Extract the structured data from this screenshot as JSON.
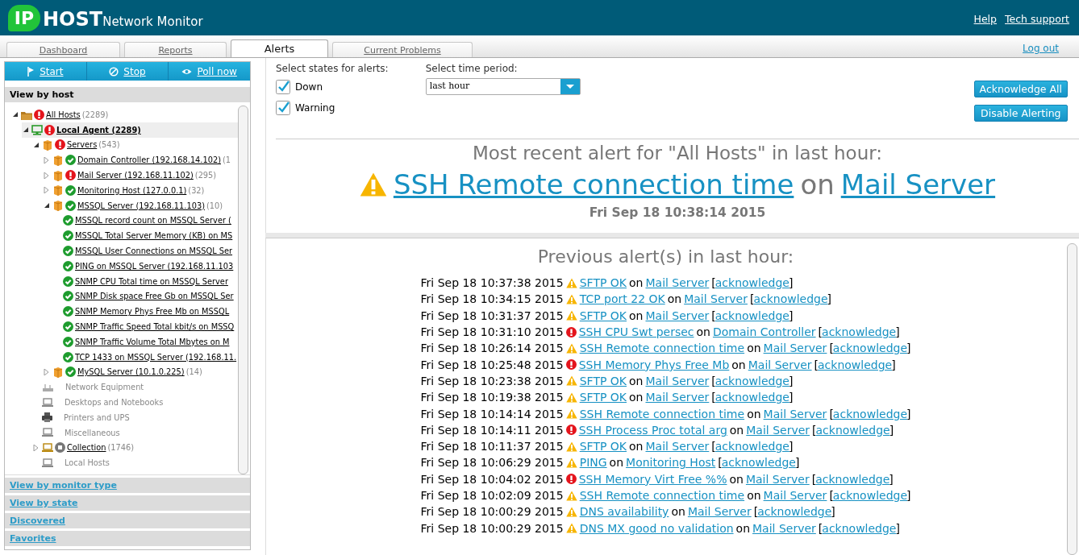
{
  "header": {
    "logo_badge": "IP",
    "logo_word": "HOST",
    "product": "Network Monitor",
    "links": [
      "Help",
      "Tech support"
    ]
  },
  "tabs": [
    {
      "label": "Dashboard",
      "selected": false
    },
    {
      "label": "Reports",
      "selected": false
    },
    {
      "label": "Alerts",
      "selected": true
    },
    {
      "label": "Current Problems",
      "selected": false
    }
  ],
  "logout": "Log out",
  "sidebar": {
    "actions": [
      {
        "kind": "start",
        "label": "Start"
      },
      {
        "kind": "stop",
        "label": "Stop"
      },
      {
        "kind": "poll",
        "label": "Poll now"
      }
    ],
    "active_section": "View by host",
    "tree": [
      {
        "kind": "folder",
        "down": true,
        "label": "All Hosts",
        "count": "(2289)",
        "expanded": true,
        "children": [
          {
            "kind": "agent",
            "down": true,
            "label": "Local Agent (2289)",
            "selected": true,
            "expanded": true,
            "children": [
              {
                "kind": "group",
                "down": true,
                "label": "Servers",
                "count": "(543)",
                "expanded": true,
                "children": [
                  {
                    "kind": "host",
                    "down": false,
                    "label": "Domain Controller (192.168.14.102)",
                    "count": "(1",
                    "expanded": false
                  },
                  {
                    "kind": "host",
                    "down": true,
                    "label": "Mail Server (192.168.11.102)",
                    "count": "(295)",
                    "expanded": false
                  },
                  {
                    "kind": "host",
                    "down": false,
                    "label": "Monitoring Host (127.0.0.1)",
                    "count": "(32)",
                    "expanded": false
                  },
                  {
                    "kind": "host",
                    "down": false,
                    "label": "MSSQL Server (192.168.11.103)",
                    "count": "(10)",
                    "expanded": true,
                    "children": [
                      {
                        "kind": "monitor",
                        "down": false,
                        "label": "MSSQL record count on MSSQL Server ("
                      },
                      {
                        "kind": "monitor",
                        "down": false,
                        "label": "MSSQL Total Server Memory (KB) on MS"
                      },
                      {
                        "kind": "monitor",
                        "down": false,
                        "label": "MSSQL User Connections on MSSQL Ser"
                      },
                      {
                        "kind": "monitor",
                        "down": false,
                        "label": "PING on MSSQL Server (192.168.11.103"
                      },
                      {
                        "kind": "monitor",
                        "down": false,
                        "label": "SNMP CPU Total time on MSSQL Server"
                      },
                      {
                        "kind": "monitor",
                        "down": false,
                        "label": "SNMP Disk space Free Gb on MSSQL Ser"
                      },
                      {
                        "kind": "monitor",
                        "down": false,
                        "label": "SNMP Memory Phys Free Mb on MSSQL"
                      },
                      {
                        "kind": "monitor",
                        "down": false,
                        "label": "SNMP Traffic Speed Total kbit/s on MSSQ"
                      },
                      {
                        "kind": "monitor",
                        "down": false,
                        "label": "SNMP Traffic Volume Total Mbytes on M"
                      },
                      {
                        "kind": "monitor",
                        "down": false,
                        "label": "TCP 1433 on MSSQL Server (192.168.11."
                      }
                    ]
                  },
                  {
                    "kind": "host",
                    "down": false,
                    "label": "MySQL Server (10.1.0.225)",
                    "count": "(14)",
                    "expanded": false
                  }
                ]
              },
              {
                "kind": "network",
                "label": "Network Equipment"
              },
              {
                "kind": "computer",
                "label": "Desktops and Notebooks"
              },
              {
                "kind": "printer",
                "label": "Printers and UPS"
              },
              {
                "kind": "computer",
                "label": "Miscellaneous"
              },
              {
                "kind": "collection",
                "paused": true,
                "label": "Collection",
                "count": "(1746)",
                "expanded": false
              },
              {
                "kind": "computer",
                "label": "Local Hosts"
              }
            ]
          }
        ]
      }
    ],
    "sections": [
      "View by monitor type",
      "View by state",
      "Discovered",
      "Favorites"
    ]
  },
  "filters": {
    "states_label": "Select states for alerts:",
    "states": [
      {
        "label": "Down",
        "checked": true
      },
      {
        "label": "Warning",
        "checked": true
      }
    ],
    "period_label": "Select time period:",
    "period": "last hour"
  },
  "buttons": [
    "Acknowledge All",
    "Disable Alerting"
  ],
  "recent": {
    "title": "Most recent alert for \"All Hosts\" in last hour:",
    "kind": "warning",
    "monitor": "SSH Remote connection time",
    "on": "on",
    "host": "Mail Server",
    "time": "Fri Sep 18 10:38:14 2015"
  },
  "previous": {
    "title": "Previous alert(s) in last hour:",
    "alerts": [
      {
        "time": "Fri Sep 18 10:37:38 2015",
        "kind": "warning",
        "monitor": "SFTP OK",
        "on": "on",
        "host": "Mail Server",
        "open": "[",
        "action": "acknowledge",
        "close": "]"
      },
      {
        "time": "Fri Sep 18 10:34:15 2015",
        "kind": "warning",
        "monitor": "TCP port 22 OK",
        "on": "on",
        "host": "Mail Server",
        "open": "[",
        "action": "acknowledge",
        "close": "]"
      },
      {
        "time": "Fri Sep 18 10:31:37 2015",
        "kind": "warning",
        "monitor": "SFTP OK",
        "on": "on",
        "host": "Mail Server",
        "open": "[",
        "action": "acknowledge",
        "close": "]"
      },
      {
        "time": "Fri Sep 18 10:31:10 2015",
        "kind": "down",
        "monitor": "SSH CPU Swt persec",
        "on": "on",
        "host": "Domain Controller",
        "open": "[",
        "action": "acknowledge",
        "close": "]"
      },
      {
        "time": "Fri Sep 18 10:26:14 2015",
        "kind": "warning",
        "monitor": "SSH Remote connection time",
        "on": "on",
        "host": "Mail Server",
        "open": "[",
        "action": "acknowledge",
        "close": "]"
      },
      {
        "time": "Fri Sep 18 10:25:48 2015",
        "kind": "down",
        "monitor": "SSH Memory Phys Free Mb",
        "on": "on",
        "host": "Mail Server",
        "open": "[",
        "action": "acknowledge",
        "close": "]"
      },
      {
        "time": "Fri Sep 18 10:23:38 2015",
        "kind": "warning",
        "monitor": "SFTP OK",
        "on": "on",
        "host": "Mail Server",
        "open": "[",
        "action": "acknowledge",
        "close": "]"
      },
      {
        "time": "Fri Sep 18 10:19:38 2015",
        "kind": "warning",
        "monitor": "SFTP OK",
        "on": "on",
        "host": "Mail Server",
        "open": "[",
        "action": "acknowledge",
        "close": "]"
      },
      {
        "time": "Fri Sep 18 10:14:14 2015",
        "kind": "warning",
        "monitor": "SSH Remote connection time",
        "on": "on",
        "host": "Mail Server",
        "open": "[",
        "action": "acknowledge",
        "close": "]"
      },
      {
        "time": "Fri Sep 18 10:14:11 2015",
        "kind": "down",
        "monitor": "SSH Process Proc total arg",
        "on": "on",
        "host": "Mail Server",
        "open": "[",
        "action": "acknowledge",
        "close": "]"
      },
      {
        "time": "Fri Sep 18 10:11:37 2015",
        "kind": "warning",
        "monitor": "SFTP OK",
        "on": "on",
        "host": "Mail Server",
        "open": "[",
        "action": "acknowledge",
        "close": "]"
      },
      {
        "time": "Fri Sep 18 10:06:29 2015",
        "kind": "warning",
        "monitor": "PING",
        "on": "on",
        "host": "Monitoring Host",
        "open": "[",
        "action": "acknowledge",
        "close": "]"
      },
      {
        "time": "Fri Sep 18 10:04:02 2015",
        "kind": "down",
        "monitor": "SSH Memory Virt Free %%",
        "on": "on",
        "host": "Mail Server",
        "open": "[",
        "action": "acknowledge",
        "close": "]"
      },
      {
        "time": "Fri Sep 18 10:02:09 2015",
        "kind": "warning",
        "monitor": "SSH Remote connection time",
        "on": "on",
        "host": "Mail Server",
        "open": "[",
        "action": "acknowledge",
        "close": "]"
      },
      {
        "time": "Fri Sep 18 10:00:29 2015",
        "kind": "warning",
        "monitor": "DNS availability",
        "on": "on",
        "host": "Mail Server",
        "open": "[",
        "action": "acknowledge",
        "close": "]"
      },
      {
        "time": "Fri Sep 18 10:00:29 2015",
        "kind": "warning",
        "monitor": "DNS MX good no validation",
        "on": "on",
        "host": "Mail Server",
        "open": "[",
        "action": "acknowledge",
        "close": "]"
      }
    ]
  }
}
